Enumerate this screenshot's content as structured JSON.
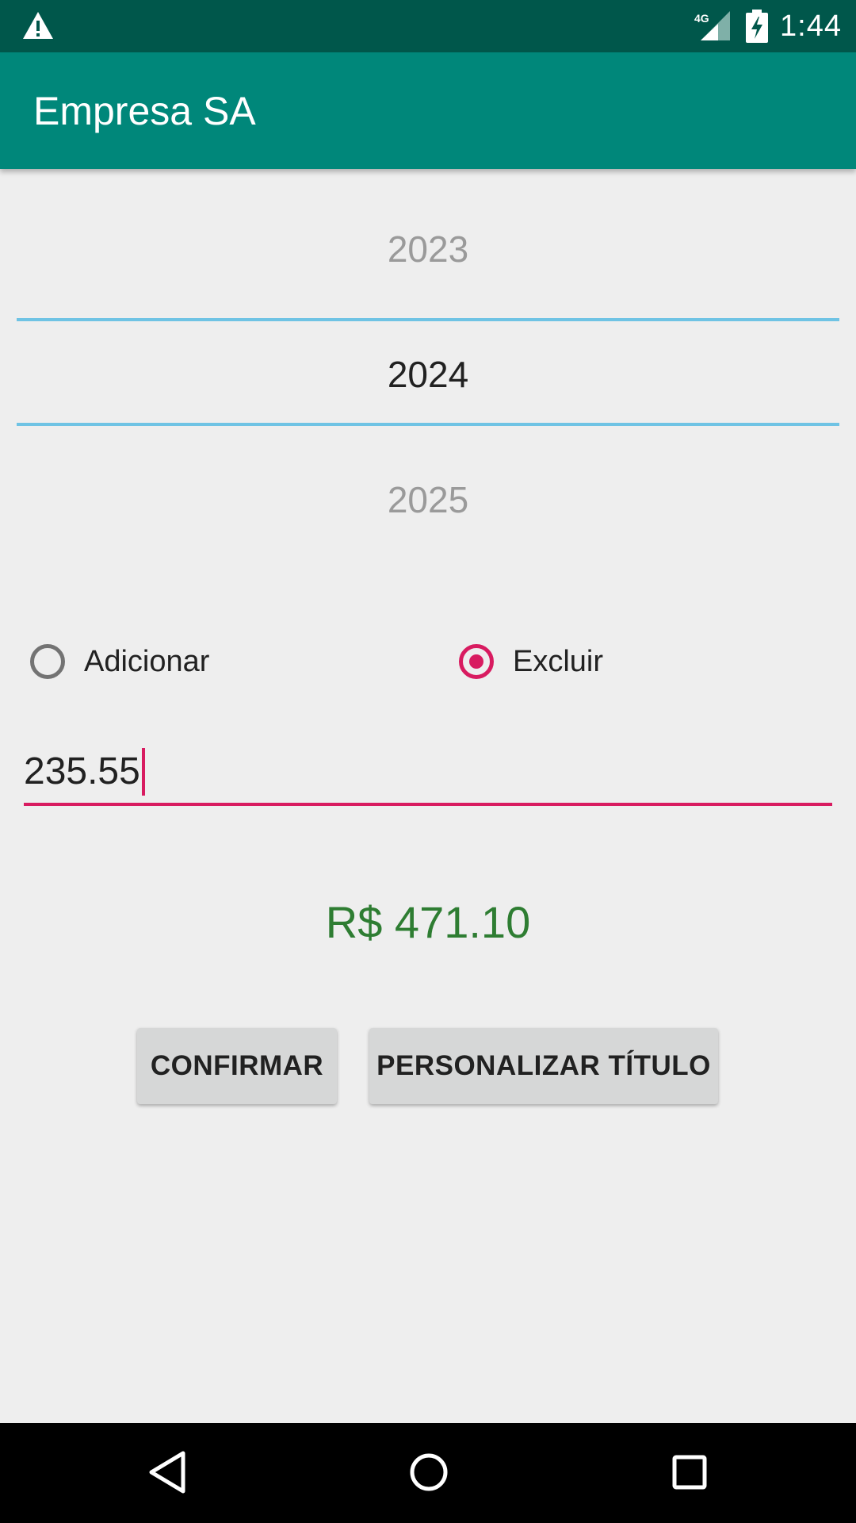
{
  "status_bar": {
    "time": "1:44",
    "network": "4G",
    "icons": [
      "warning-icon",
      "signal-icon",
      "battery-charging-icon"
    ]
  },
  "app_bar": {
    "title": "Empresa SA"
  },
  "year_picker": {
    "previous": "2023",
    "selected": "2024",
    "next": "2025",
    "divider_color": "#6fc3e4"
  },
  "radio_group": {
    "options": [
      {
        "label": "Adicionar",
        "checked": false
      },
      {
        "label": "Excluir",
        "checked": true
      }
    ],
    "accent_color": "#d81b60"
  },
  "amount_input": {
    "value": "235.55"
  },
  "result": {
    "text": "R$ 471.10",
    "color": "#2e7d32"
  },
  "buttons": {
    "confirm": "CONFIRMAR",
    "customize_title": "PERSONALIZAR TÍTULO"
  },
  "nav_bar": {
    "icons": [
      "back-icon",
      "home-icon",
      "recents-icon"
    ]
  }
}
